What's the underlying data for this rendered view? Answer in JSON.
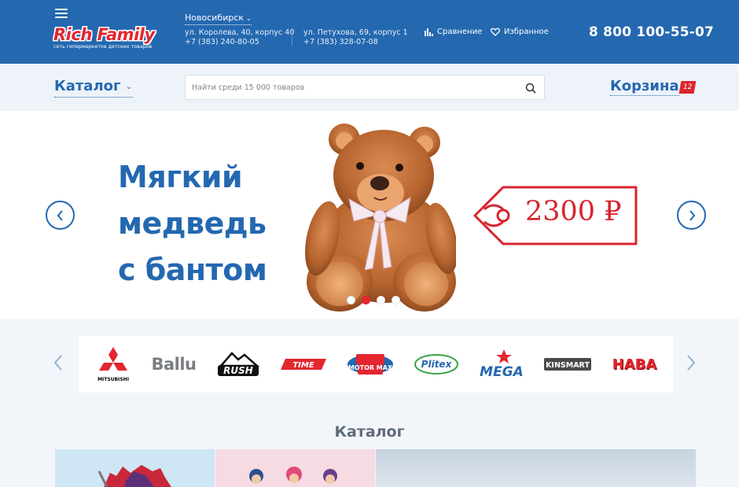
{
  "header": {
    "logo_text": "Rich Family",
    "logo_tagline": "сеть гипермаркетов детских товаров",
    "city": "Новосибирск",
    "stores": [
      {
        "address": "ул. Королева, 40, корпус 40",
        "phone": "+7 (383) 240-80-05"
      },
      {
        "address": "ул. Петухова, 69, корпус 1",
        "phone": "+7 (383) 328-07-08"
      }
    ],
    "compare_label": "Сравнение",
    "favorites_label": "Избранное",
    "hotline": "8 800 100-55-07"
  },
  "catalog_bar": {
    "catalog_label": "Каталог",
    "search_placeholder": "Найти среди 15 000 товаров",
    "cart_label": "Корзина",
    "cart_count": "12"
  },
  "hero": {
    "title_lines": [
      "Мягкий",
      "медведь",
      "с бантом"
    ],
    "price": "2300 ₽",
    "slide_count": 4,
    "active_slide": 1
  },
  "brands": [
    "MITSUBISHI",
    "Ballu",
    "RUSH",
    "TIME",
    "MOTOR MAX",
    "Plitex",
    "MEGA",
    "KINSMART",
    "HABA"
  ],
  "catalog_section": {
    "title": "Каталог"
  },
  "colors": {
    "brand_blue": "#2468b0",
    "accent_red": "#d9252e",
    "background": "#f2f6fa"
  }
}
